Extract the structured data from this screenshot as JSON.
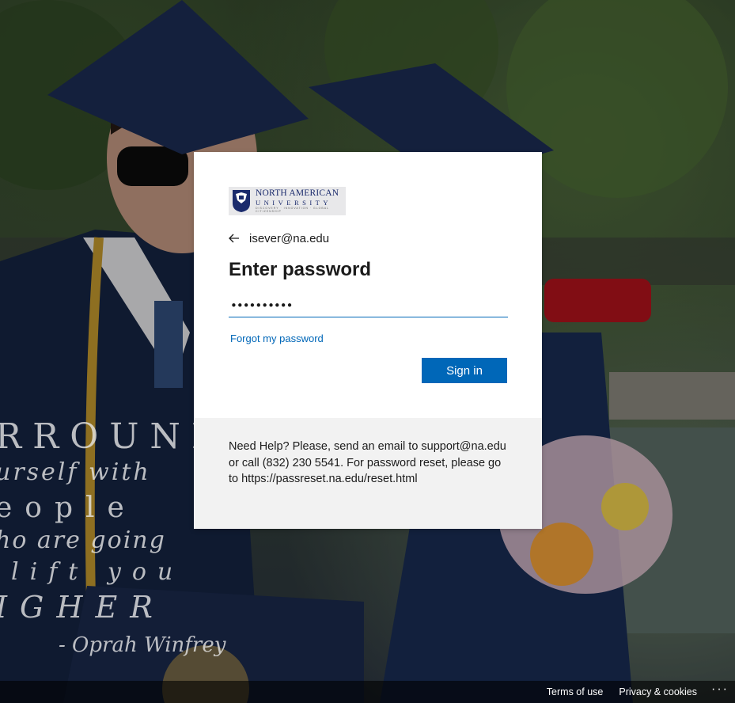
{
  "colors": {
    "accent": "#0067b8",
    "card_bg": "#ffffff",
    "help_bg": "#f2f2f2",
    "footer_bg": "rgba(0,0,0,0.6)"
  },
  "background": {
    "quote_lines": [
      "RROUND",
      "urself with",
      "eople",
      "ho are going",
      "lift you",
      "IGHER",
      "- Oprah Winfrey"
    ]
  },
  "logo": {
    "name": "NORTH AMERICAN",
    "subname": "UNIVERSITY",
    "tagline": "DISCOVERY · INNOVATION · GLOBAL CITIZENSHIP"
  },
  "identity": {
    "back_icon": "back-arrow-icon",
    "email": "isever@na.edu"
  },
  "form": {
    "title": "Enter password",
    "password_value": "••••••••••",
    "forgot_link": "Forgot my password",
    "signin_label": "Sign in"
  },
  "help": {
    "text": "Need Help? Please, send an email to support@na.edu or call (832) 230 5541. For password reset, please go to https://passreset.na.edu/reset.html"
  },
  "footer": {
    "terms": "Terms of use",
    "privacy": "Privacy & cookies",
    "more": "···"
  }
}
